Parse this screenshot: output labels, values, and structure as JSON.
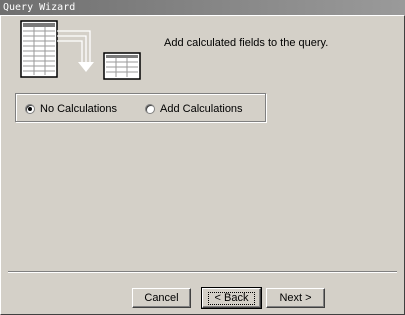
{
  "window": {
    "title": "Query Wizard"
  },
  "main": {
    "heading": "Add calculated fields to the query.",
    "options": [
      {
        "label": "No Calculations",
        "selected": true
      },
      {
        "label": "Add Calculations",
        "selected": false
      }
    ]
  },
  "buttons": {
    "cancel": "Cancel",
    "back": "< Back",
    "next": "Next >"
  },
  "colors": {
    "dialog_bg": "#d4d0c8",
    "titlebar": "#808080"
  }
}
